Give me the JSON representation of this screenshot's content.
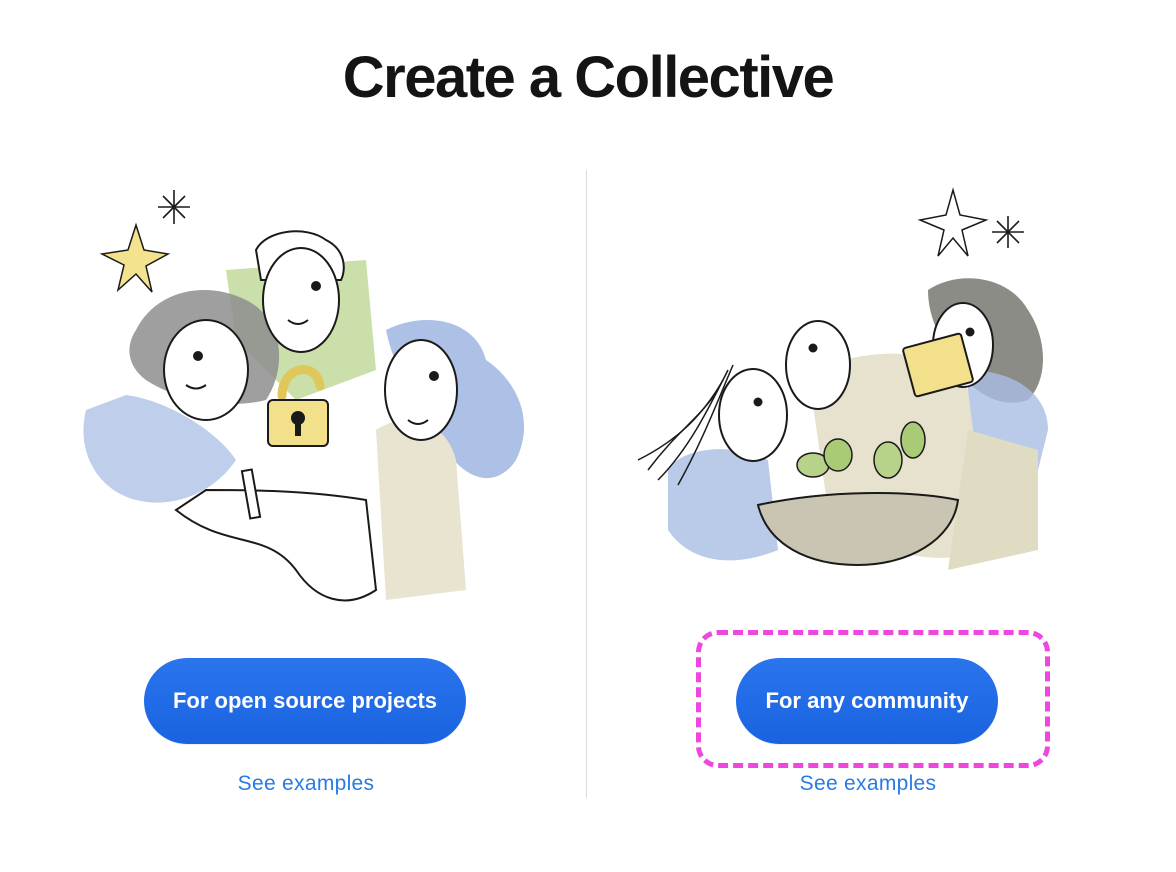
{
  "page": {
    "title": "Create a Collective"
  },
  "options": [
    {
      "button_label": "For open source projects",
      "examples_label": "See examples",
      "illustration": "people-with-padlock-illustration"
    },
    {
      "button_label": "For any community",
      "examples_label": "See examples",
      "illustration": "community-growing-plants-illustration"
    }
  ],
  "colors": {
    "primary_button": "#1d68e6",
    "link": "#2a7ae2",
    "highlight_annotation": "#ee33dd"
  }
}
